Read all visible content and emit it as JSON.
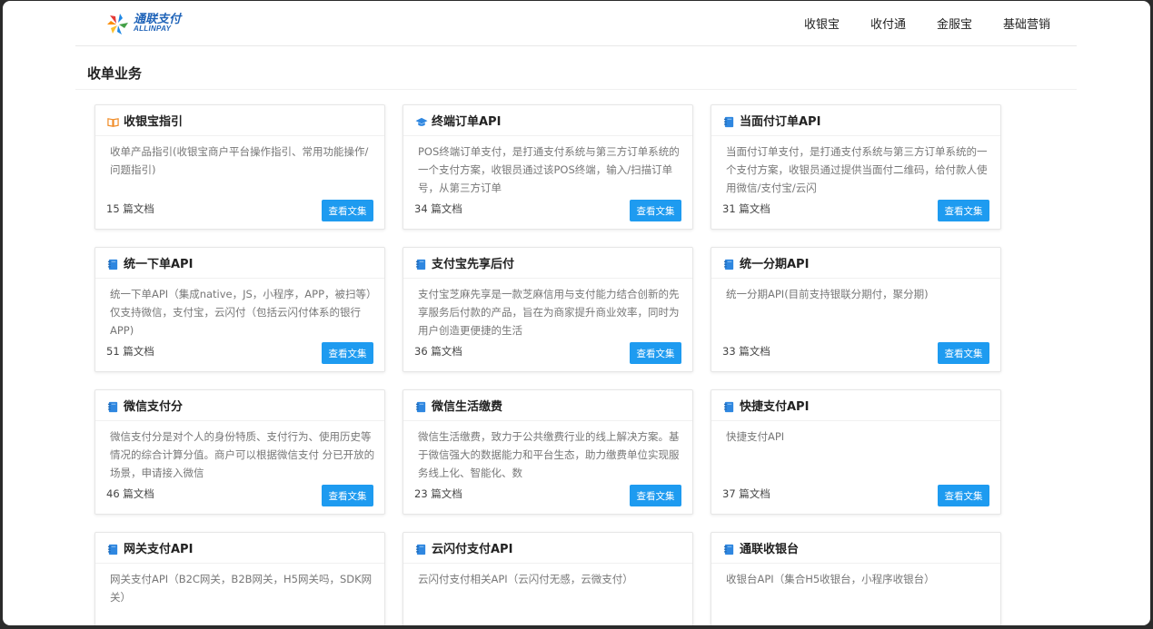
{
  "brand": {
    "name_cn": "通联支付",
    "name_en": "ALLINPAY"
  },
  "nav": [
    {
      "label": "收银宝"
    },
    {
      "label": "收付通"
    },
    {
      "label": "金服宝"
    },
    {
      "label": "基础营销"
    }
  ],
  "section": {
    "title": "收单业务"
  },
  "button_label": "查看文集",
  "colors": {
    "primary_button": "#1e9bf0",
    "book_icon_orange": "#f08a24",
    "icon_blue": "#2f87e0"
  },
  "cards": [
    {
      "title": "收银宝指引",
      "icon": "open-book-icon",
      "desc": "收单产品指引(收银宝商户平台操作指引、常用功能操作/问题指引)",
      "count": "15 篇文档"
    },
    {
      "title": "终端订单API",
      "icon": "graduation-cap-icon",
      "desc": "POS终端订单支付，是打通支付系统与第三方订单系统的一个支付方案，收银员通过该POS终端，输入/扫描订单号，从第三方订单",
      "count": "34 篇文档"
    },
    {
      "title": "当面付订单API",
      "icon": "notebook-icon",
      "desc": "当面付订单支付，是打通支付系统与第三方订单系统的一个支付方案，收银员通过提供当面付二维码，给付款人使用微信/支付宝/云闪",
      "count": "31 篇文档"
    },
    {
      "title": "统一下单API",
      "icon": "notebook-icon",
      "desc": "统一下单API（集成native，JS，小程序，APP，被扫等）仅支持微信，支付宝，云闪付（包括云闪付体系的银行APP)",
      "count": "51 篇文档"
    },
    {
      "title": "支付宝先享后付",
      "icon": "notebook-icon",
      "desc": "支付宝芝麻先享是一款芝麻信用与支付能力结合创新的先享服务后付款的产品，旨在为商家提升商业效率，同时为用户创造更便捷的生活",
      "count": "36 篇文档"
    },
    {
      "title": "统一分期API",
      "icon": "notebook-icon",
      "desc": "统一分期API(目前支持银联分期付，聚分期)",
      "count": "33 篇文档"
    },
    {
      "title": "微信支付分",
      "icon": "notebook-icon",
      "desc": "微信支付分是对个人的身份特质、支付行为、使用历史等情况的综合计算分值。商户可以根据微信支付 分已开放的场景，申请接入微信",
      "count": "46 篇文档"
    },
    {
      "title": "微信生活缴费",
      "icon": "notebook-icon",
      "desc": "微信生活缴费，致力于公共缴费行业的线上解决方案。基于微信强大的数据能力和平台生态，助力缴费单位实现服务线上化、智能化、数",
      "count": "23 篇文档"
    },
    {
      "title": "快捷支付API",
      "icon": "notebook-icon",
      "desc": "快捷支付API",
      "count": "37 篇文档"
    },
    {
      "title": "网关支付API",
      "icon": "notebook-icon",
      "desc": "网关支付API（B2C网关，B2B网关，H5网关吗，SDK网关）",
      "count": ""
    },
    {
      "title": "云闪付支付API",
      "icon": "notebook-icon",
      "desc": "云闪付支付相关API（云闪付无感，云微支付）",
      "count": ""
    },
    {
      "title": "通联收银台",
      "icon": "notebook-icon",
      "desc": "收银台API（集合H5收银台，小程序收银台）",
      "count": ""
    }
  ]
}
